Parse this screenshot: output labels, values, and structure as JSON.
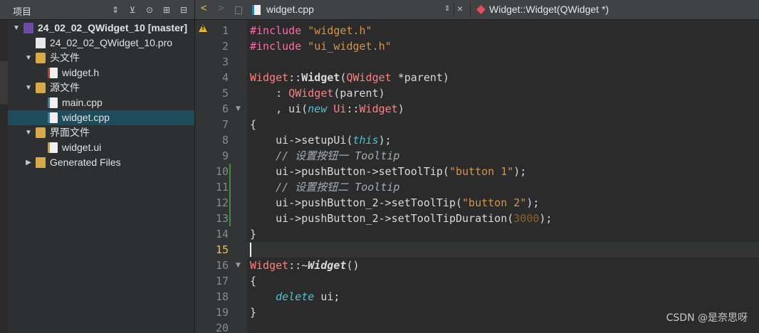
{
  "project_panel": {
    "title": "项目",
    "header_icons": [
      "⇕",
      "⊻",
      "⊙",
      "⊞",
      "⊟"
    ],
    "tree": [
      {
        "label": "24_02_02_QWidget_10 [master]",
        "depth": 0,
        "expanded": true,
        "icon": "project-icon",
        "bold": true
      },
      {
        "label": "24_02_02_QWidget_10.pro",
        "depth": 1,
        "icon": "pro-file-icon"
      },
      {
        "label": "头文件",
        "depth": 1,
        "expanded": true,
        "icon": "header-folder-icon"
      },
      {
        "label": "widget.h",
        "depth": 2,
        "icon": "h-file-icon"
      },
      {
        "label": "源文件",
        "depth": 1,
        "expanded": true,
        "icon": "source-folder-icon"
      },
      {
        "label": "main.cpp",
        "depth": 2,
        "icon": "cpp-file-icon"
      },
      {
        "label": "widget.cpp",
        "depth": 2,
        "icon": "cpp-file-icon",
        "selected": true
      },
      {
        "label": "界面文件",
        "depth": 1,
        "expanded": true,
        "icon": "form-folder-icon"
      },
      {
        "label": "widget.ui",
        "depth": 2,
        "icon": "ui-file-icon"
      },
      {
        "label": "Generated Files",
        "depth": 1,
        "expanded": false,
        "icon": "generated-folder-icon"
      }
    ]
  },
  "editor_tab": {
    "back": "<",
    "forward": ">",
    "file_name": "widget.cpp",
    "file_switch_arrows": "⇕",
    "close": "×",
    "symbol": "Widget::Widget(QWidget *)"
  },
  "editor": {
    "current_line": 15,
    "warning_line": 1,
    "modified_lines": [
      10,
      11,
      12,
      13
    ],
    "fold_markers": [
      6,
      16
    ],
    "lines": [
      {
        "n": "1"
      },
      {
        "n": "2"
      },
      {
        "n": "3"
      },
      {
        "n": "4"
      },
      {
        "n": "5"
      },
      {
        "n": "6"
      },
      {
        "n": "7"
      },
      {
        "n": "8"
      },
      {
        "n": "9"
      },
      {
        "n": "10"
      },
      {
        "n": "11"
      },
      {
        "n": "12"
      },
      {
        "n": "13"
      },
      {
        "n": "14"
      },
      {
        "n": "15"
      },
      {
        "n": "16"
      },
      {
        "n": "17"
      },
      {
        "n": "18"
      },
      {
        "n": "19"
      },
      {
        "n": "20"
      }
    ],
    "code": [
      [
        [
          "t-pp",
          "#include "
        ],
        [
          "t-str",
          "\"widget.h\""
        ]
      ],
      [
        [
          "t-pp",
          "#include "
        ],
        [
          "t-str",
          "\"ui_widget.h\""
        ]
      ],
      [],
      [
        [
          "t-cls",
          "Widget"
        ],
        [
          "t-def",
          "::"
        ],
        [
          "t-fn t-bold",
          "Widget"
        ],
        [
          "t-def",
          "("
        ],
        [
          "t-cls",
          "QWidget"
        ],
        [
          "t-def",
          " *parent)"
        ]
      ],
      [
        [
          "t-def",
          "    : "
        ],
        [
          "t-cls",
          "QWidget"
        ],
        [
          "t-def",
          "(parent)"
        ]
      ],
      [
        [
          "t-def",
          "    , ui("
        ],
        [
          "t-kw",
          "new"
        ],
        [
          "t-def",
          " "
        ],
        [
          "t-cls",
          "Ui"
        ],
        [
          "t-def",
          "::"
        ],
        [
          "t-cls",
          "Widget"
        ],
        [
          "t-def",
          ")"
        ]
      ],
      [
        [
          "t-def",
          "{"
        ]
      ],
      [
        [
          "t-def",
          "    ui->setupUi("
        ],
        [
          "t-kw",
          "this"
        ],
        [
          "t-def",
          ");"
        ]
      ],
      [
        [
          "t-cmt",
          "    // 设置按钮一 Tooltip"
        ]
      ],
      [
        [
          "t-def",
          "    ui->pushButton->setToolTip("
        ],
        [
          "t-str",
          "\"button 1\""
        ],
        [
          "t-def",
          ");"
        ]
      ],
      [
        [
          "t-cmt",
          "    // 设置按钮二 Tooltip"
        ]
      ],
      [
        [
          "t-def",
          "    ui->pushButton_2->setToolTip("
        ],
        [
          "t-str",
          "\"button 2\""
        ],
        [
          "t-def",
          ");"
        ]
      ],
      [
        [
          "t-def",
          "    ui->pushButton_2->setToolTipDuration("
        ],
        [
          "t-num",
          "3000"
        ],
        [
          "t-def",
          ");"
        ]
      ],
      [
        [
          "t-def",
          "}"
        ]
      ],
      [],
      [
        [
          "t-cls",
          "Widget"
        ],
        [
          "t-def",
          "::~"
        ],
        [
          "t-dtor",
          "Widget"
        ],
        [
          "t-def",
          "()"
        ]
      ],
      [
        [
          "t-def",
          "{"
        ]
      ],
      [
        [
          "t-def",
          "    "
        ],
        [
          "t-kw",
          "delete"
        ],
        [
          "t-def",
          " ui;"
        ]
      ],
      [
        [
          "t-def",
          "}"
        ]
      ],
      []
    ]
  },
  "watermark": "CSDN @是奈思呀"
}
